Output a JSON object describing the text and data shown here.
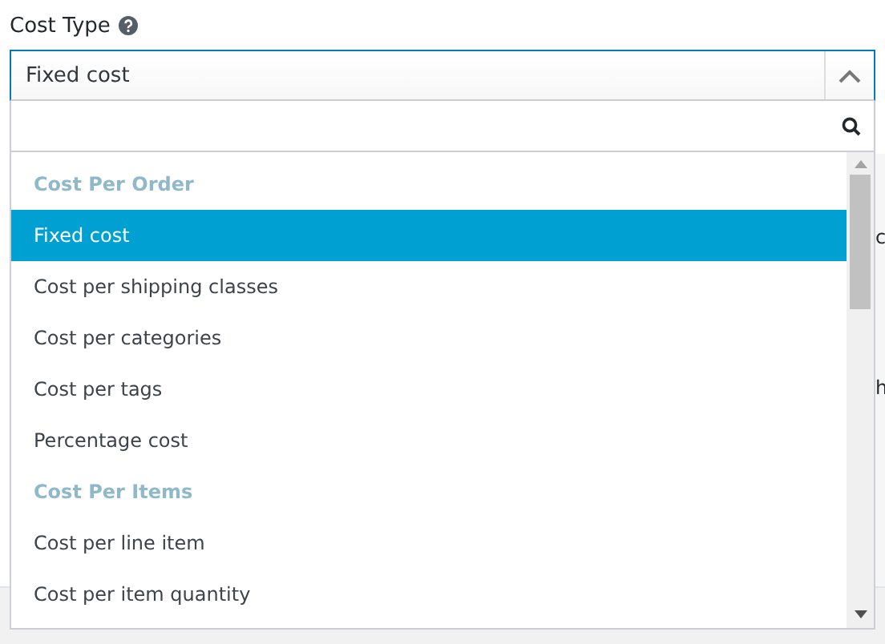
{
  "field": {
    "label": "Cost Type",
    "value": "Fixed cost",
    "expanded": true
  },
  "options": [
    {
      "kind": "group",
      "label": "Cost Per Order"
    },
    {
      "kind": "option",
      "label": "Fixed cost",
      "selected": true
    },
    {
      "kind": "option",
      "label": "Cost per shipping classes",
      "selected": false
    },
    {
      "kind": "option",
      "label": "Cost per categories",
      "selected": false
    },
    {
      "kind": "option",
      "label": "Cost per tags",
      "selected": false
    },
    {
      "kind": "option",
      "label": "Percentage cost",
      "selected": false
    },
    {
      "kind": "group",
      "label": "Cost Per Items"
    },
    {
      "kind": "option",
      "label": "Cost per line item",
      "selected": false
    },
    {
      "kind": "option",
      "label": "Cost per item quantity",
      "selected": false
    }
  ],
  "background_fragments": [
    "c",
    "h"
  ]
}
